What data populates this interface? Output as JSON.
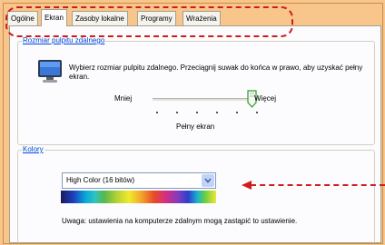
{
  "tabs": [
    {
      "label": "Ogólne",
      "active": false
    },
    {
      "label": "Ekran",
      "active": true
    },
    {
      "label": "Zasoby lokalne",
      "active": false
    },
    {
      "label": "Programy",
      "active": false
    },
    {
      "label": "Wrażenia",
      "active": false
    }
  ],
  "display_size": {
    "group_title": "Rozmiar pulpitu zdalnego",
    "description": "Wybierz rozmiar pulpitu zdalnego. Przeciągnij suwak do końca w prawo, aby uzyskać pełny ekran.",
    "less_label": "Mniej",
    "more_label": "Więcej",
    "current_value": "Pełny ekran",
    "slider_fraction": 1.0,
    "icon": "monitor-icon"
  },
  "colors": {
    "group_title": "Kolory",
    "selected_depth": "High Color (16 bitów)",
    "note": "Uwaga: ustawienia na komputerze zdalnym mogą zastąpić to ustawienie."
  },
  "annotations": {
    "highlight_color": "#d11c1c"
  },
  "theme": {
    "background": "#f8c58b",
    "panel": "#fcfcfe",
    "accent": "#0046d5"
  }
}
